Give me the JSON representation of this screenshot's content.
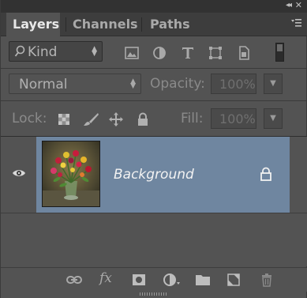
{
  "window": {
    "collapse_glyph": "◂◂",
    "close_glyph": "✕"
  },
  "tabs": [
    {
      "label": "Layers",
      "active": true
    },
    {
      "label": "Channels",
      "active": false
    },
    {
      "label": "Paths",
      "active": false
    }
  ],
  "panel_menu_icon": "panel-menu-icon",
  "filter": {
    "kind_label": "Kind",
    "icons": [
      "pixel-filter-icon",
      "adjustment-filter-icon",
      "type-filter-icon",
      "shape-filter-icon",
      "smart-object-filter-icon"
    ],
    "toggle_on": false
  },
  "blend": {
    "mode": "Normal",
    "opacity_label": "Opacity:",
    "opacity_value": "100%"
  },
  "lock": {
    "label": "Lock:",
    "icons": [
      "lock-transparent-icon",
      "lock-image-icon",
      "lock-position-icon",
      "lock-all-icon"
    ],
    "fill_label": "Fill:",
    "fill_value": "100%"
  },
  "layers": [
    {
      "name": "Background",
      "visible": true,
      "locked": true,
      "selected": true
    }
  ],
  "bottom_icons": [
    "link-layers-icon",
    "fx-icon",
    "add-mask-icon",
    "adjustment-layer-icon",
    "new-group-icon",
    "new-layer-icon",
    "trash-icon"
  ],
  "bottom_fx_label": "fx",
  "colors": {
    "panel_bg": "#535353",
    "tab_bar_bg": "#3d3d3d",
    "selected_layer_bg": "#6f86a0"
  }
}
